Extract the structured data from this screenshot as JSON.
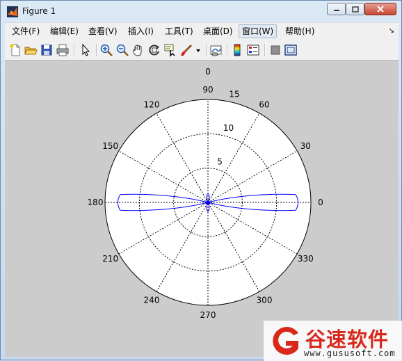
{
  "window": {
    "title": "Figure 1",
    "menus": [
      "文件(F)",
      "编辑(E)",
      "查看(V)",
      "插入(I)",
      "工具(T)",
      "桌面(D)",
      "窗口(W)",
      "帮助(H)"
    ],
    "active_menu": "窗口(W)"
  },
  "toolbar_icons": [
    "new-figure-icon",
    "open-file-icon",
    "save-icon",
    "print-icon",
    "pointer-icon",
    "zoom-in-icon",
    "zoom-out-icon",
    "pan-icon",
    "rotate-3d-icon",
    "data-cursor-icon",
    "brush-icon",
    "dropdown-arrow-icon",
    "link-plot-icon",
    "colorbar-icon",
    "legend-icon",
    "hide-plot-tools-icon",
    "show-plot-tools-icon"
  ],
  "chart_data": {
    "type": "polar",
    "title": "0",
    "angle_labels": [
      "0",
      "30",
      "60",
      "90",
      "120",
      "150",
      "180",
      "210",
      "240",
      "270",
      "300",
      "330"
    ],
    "radial_ticks": [
      5,
      10,
      15
    ],
    "radial_tick_labels": [
      "5",
      "10",
      "15"
    ],
    "rmax": 15,
    "grid": true,
    "series": [
      {
        "color": "#0000ff",
        "shape": "two-lobe pattern along 0°–180° axis with small lobes along 90°–270° axis",
        "r_at_0deg": 13.5,
        "r_at_180deg": 13.5,
        "r_at_90deg": 1.3,
        "r_at_270deg": 1.3,
        "lobe_half_width_r": 1.2
      }
    ]
  },
  "watermark": {
    "brand": "谷速软件",
    "url": "www.gususoft.com",
    "brand_color": "#d8281c"
  }
}
